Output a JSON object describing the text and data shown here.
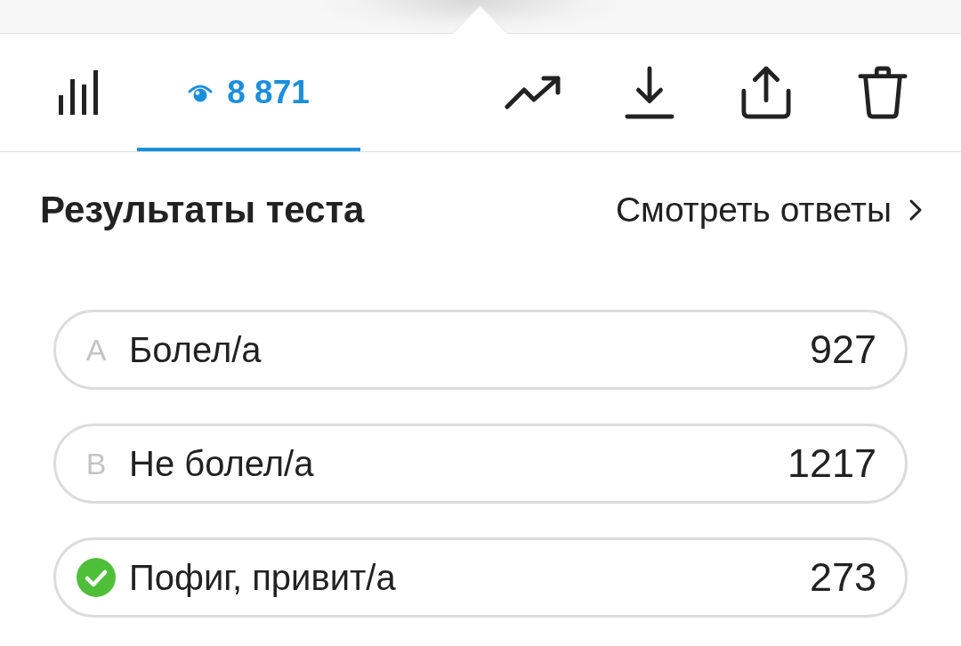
{
  "tabs": [
    {
      "kind": "stats",
      "selected": false
    },
    {
      "kind": "views",
      "label": "8 871",
      "selected": true
    }
  ],
  "actions": [
    {
      "kind": "trend"
    },
    {
      "kind": "download"
    },
    {
      "kind": "share"
    },
    {
      "kind": "delete"
    }
  ],
  "results": {
    "title": "Результаты теста",
    "link": "Смотреть ответы"
  },
  "options": [
    {
      "letter": "A",
      "label": "Болел/а",
      "count": "927",
      "correct": false
    },
    {
      "letter": "B",
      "label": "Не болел/а",
      "count": "1217",
      "correct": false
    },
    {
      "label": "Пофиг, привит/а",
      "count": "273",
      "correct": true
    }
  ]
}
